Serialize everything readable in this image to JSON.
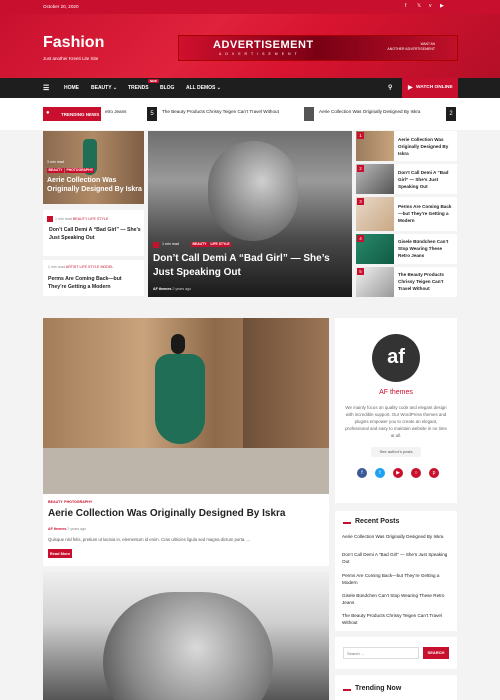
{
  "topbar": {
    "date": "October 20, 2020",
    "social_icons": [
      "facebook-icon",
      "twitter-icon",
      "vimeo-icon",
      "youtube-icon"
    ]
  },
  "header": {
    "title": "Fashion",
    "tagline": "Just another Kreeti Lite Site"
  },
  "ad": {
    "headline": "ADVERTISEMENT",
    "subline": "ADVERTISEMENT",
    "right_top": "WANT AN",
    "right_bottom": "ANOTHER ADVERTISEMENT"
  },
  "nav": {
    "items": [
      "HOME",
      "BEAUTY ⌄",
      "TRENDS",
      "BLOG",
      "ALL DEMOS ⌄"
    ],
    "new_badge": "NEW",
    "watch": "WATCH ONLINE"
  },
  "trending": {
    "label": "TRENDING NEWS",
    "items": [
      {
        "num": "",
        "text": "etro Jeans"
      },
      {
        "num": "5",
        "text": "The Beauty Products Chrissy Teigen Can’t Travel Without"
      },
      {
        "num": "",
        "text": "Aerie Collection Was Originally Designed By Iskra"
      },
      {
        "num": "2",
        "text": ""
      }
    ]
  },
  "left_cards": [
    {
      "tags": [
        "BEAUTY",
        "PHOTOGRAPHY"
      ],
      "title": "Aerie Collection Was Originally Designed By Iskra",
      "read": "3 min read"
    },
    {
      "meta": "1 min read",
      "tags": [
        "BEAUTY",
        "LIFE STYLE"
      ],
      "title": "Don’t Call Demi A “Bad Girl” — She’s Just Speaking Out"
    },
    {
      "meta": "1 min read",
      "tags": [
        "ARTIST",
        "LIFE STYLE",
        "MODEL"
      ],
      "title": "Perms Are Coming Back—but They’re Getting a Modern"
    }
  ],
  "hero": {
    "read": "1 min read",
    "tags": [
      "BEAUTY",
      "LIFE STYLE"
    ],
    "title": "Don’t Call Demi A “Bad Girl” — She’s Just Speaking Out",
    "author": "AF themes",
    "date": "2 years ago"
  },
  "side_list": [
    {
      "num": "1",
      "title": "Aerie Collection Was Originally Designed By Iskra"
    },
    {
      "num": "2",
      "title": "Don’t Call Demi A “Bad Girl” — She’s Just Speaking Out"
    },
    {
      "num": "3",
      "title": "Perms Are Coming Back—but They’re Getting a Modern"
    },
    {
      "num": "4",
      "title": "Gisele Bündchen Can’t Stop Wearing These Retro Jeans"
    },
    {
      "num": "5",
      "title": "The Beauty Products Chrissy Teigen Can’t Travel Without"
    }
  ],
  "main_post": {
    "tags": [
      "BEAUTY",
      "PHOTOGRAPHY"
    ],
    "title": "Aerie Collection Was Originally Designed By Iskra",
    "author": "AF themes",
    "date": "2 years ago",
    "excerpt": "Quisque nisl felis, pretium ut lacinia in, elementum id enim. Cras ultricies ligula sed magna dictum porta. ...",
    "read_more": "Read More"
  },
  "author_widget": {
    "logo": "af",
    "name": "AF themes",
    "bio": "We mainly focus on quality code and elegant design with incredible support. Our WordPress themes and plugins empower you to create an elegant, professional and easy to maintain website in no time at all.",
    "button": "See author's posts",
    "social": [
      {
        "icon": "facebook-icon",
        "color": "#3b5998"
      },
      {
        "icon": "twitter-icon",
        "color": "#1da1f2"
      },
      {
        "icon": "youtube-icon",
        "color": "#c8102e"
      },
      {
        "icon": "instagram-icon",
        "color": "#c8102e"
      },
      {
        "icon": "pinterest-icon",
        "color": "#c8102e"
      }
    ]
  },
  "recent_posts": {
    "heading": "Recent Posts",
    "items": [
      "Aerie Collection Was Originally Designed By Iskra",
      "Don’t Call Demi A “Bad Girl” — She’s Just Speaking Out",
      "Perms Are Coming Back—but They’re Getting a Modern",
      "Gisele Bündchen Can’t Stop Wearing These Retro Jeans",
      "The Beauty Products Chrissy Teigen Can’t Travel Without"
    ]
  },
  "search": {
    "placeholder": "Search ...",
    "button": "SEARCH"
  },
  "trending_now": {
    "heading": "Trending Now"
  },
  "colors": {
    "accent": "#c8102e",
    "dark": "#1e1e1e"
  }
}
